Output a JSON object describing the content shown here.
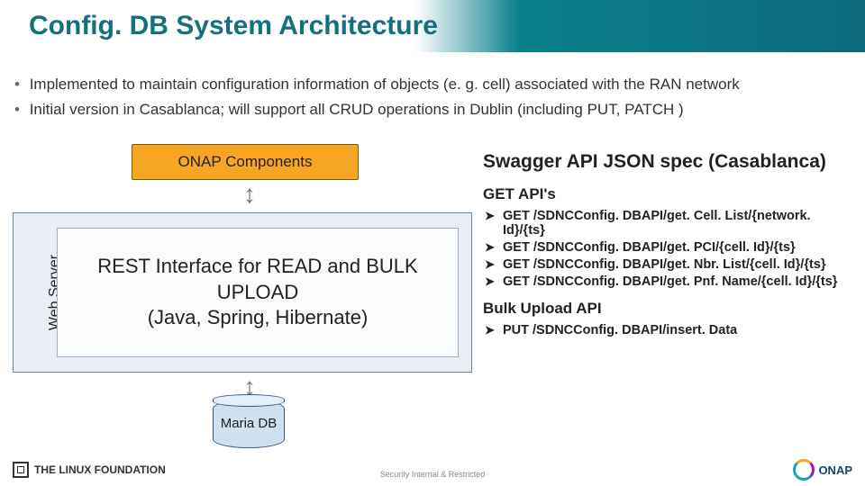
{
  "title": "Config. DB System Architecture",
  "bullets": [
    "Implemented to maintain configuration information of objects (e. g. cell) associated with the RAN network",
    "Initial version in Casablanca; will support all CRUD operations in Dublin (including PUT, PATCH )"
  ],
  "diagram": {
    "onap_label": "ONAP Components",
    "webserver_label": "Web Server",
    "rest_line1": "REST Interface for READ and BULK UPLOAD",
    "rest_line2": "(Java, Spring, Hibernate)",
    "db_label": "Maria DB"
  },
  "api": {
    "spec_title": "Swagger API JSON spec (Casablanca)",
    "get_title": "GET API's",
    "get_items": [
      "GET /SDNCConfig. DBAPI/get. Cell. List/{network. Id}/{ts}",
      "GET /SDNCConfig. DBAPI/get. PCI/{cell. Id}/{ts}",
      "GET /SDNCConfig. DBAPI/get. Nbr. List/{cell. Id}/{ts}",
      "GET /SDNCConfig. DBAPI/get. Pnf. Name/{cell. Id}/{ts}"
    ],
    "bulk_title": "Bulk Upload API",
    "bulk_items": [
      "PUT /SDNCConfig. DBAPI/insert. Data"
    ]
  },
  "footer": {
    "left": "THE LINUX FOUNDATION",
    "center": "Security Internal & Restricted",
    "right": "ONAP"
  }
}
